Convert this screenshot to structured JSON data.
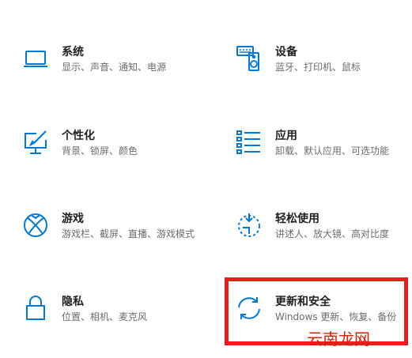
{
  "accent_color": "#0078d7",
  "highlight_color": "#e8201d",
  "settings": [
    {
      "id": "system",
      "icon": "laptop-icon",
      "title": "系统",
      "desc": "显示、声音、通知、电源"
    },
    {
      "id": "devices",
      "icon": "keyboard-speaker-icon",
      "title": "设备",
      "desc": "蓝牙、打印机、鼠标"
    },
    {
      "id": "personalization",
      "icon": "paint-monitor-icon",
      "title": "个性化",
      "desc": "背景、锁屏、颜色"
    },
    {
      "id": "apps",
      "icon": "app-list-icon",
      "title": "应用",
      "desc": "卸载、默认应用、可选功能"
    },
    {
      "id": "gaming",
      "icon": "xbox-icon",
      "title": "游戏",
      "desc": "游戏栏、截屏、直播、游戏模式"
    },
    {
      "id": "ease",
      "icon": "ease-of-access-icon",
      "title": "轻松使用",
      "desc": "讲述人、放大镜、高对比度"
    },
    {
      "id": "privacy",
      "icon": "lock-icon",
      "title": "隐私",
      "desc": "位置、相机、麦克风"
    },
    {
      "id": "update",
      "icon": "sync-icon",
      "title": "更新和安全",
      "desc": "Windows 更新、恢复、备份"
    }
  ],
  "watermark": "云南龙网"
}
